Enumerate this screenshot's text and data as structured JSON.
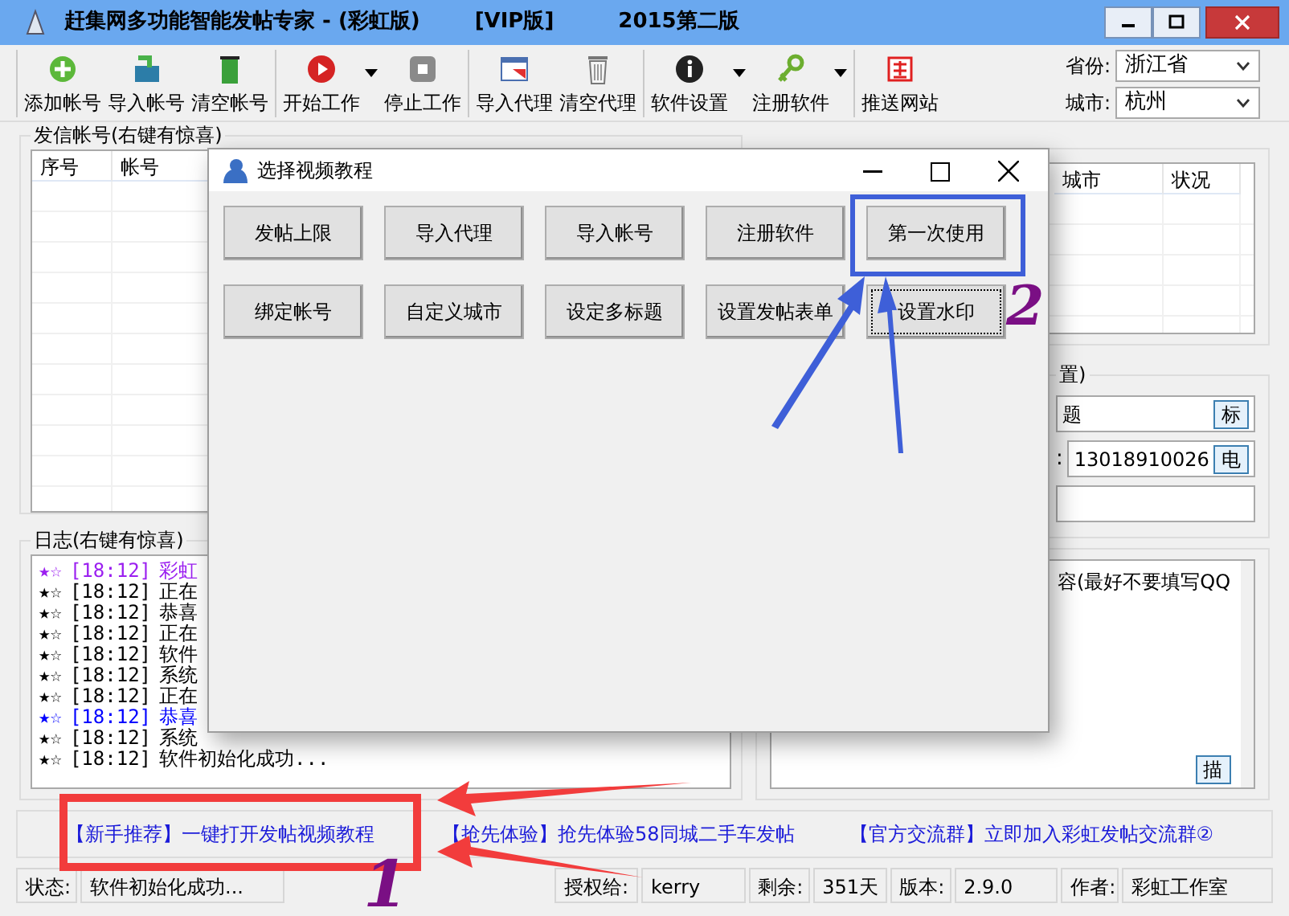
{
  "window": {
    "title_parts": [
      "赶集网多功能智能发帖专家 - (彩虹版)",
      "[VIP版]",
      "2015第二版"
    ]
  },
  "toolbar": {
    "groups": [
      [
        {
          "label": "添加帐号",
          "dropdown": false
        },
        {
          "label": "导入帐号",
          "dropdown": false
        },
        {
          "label": "清空帐号",
          "dropdown": false
        }
      ],
      [
        {
          "label": "开始工作",
          "dropdown": true
        },
        {
          "label": "停止工作",
          "dropdown": false
        }
      ],
      [
        {
          "label": "导入代理",
          "dropdown": false
        },
        {
          "label": "清空代理",
          "dropdown": false
        }
      ],
      [
        {
          "label": "软件设置",
          "dropdown": true
        },
        {
          "label": "注册软件",
          "dropdown": true
        }
      ],
      [
        {
          "label": "推送网站",
          "dropdown": false
        }
      ]
    ],
    "province": {
      "label": "省份:",
      "value": "浙江省"
    },
    "city": {
      "label": "城市:",
      "value": "杭州"
    }
  },
  "accounts": {
    "title": "发信帐号(右键有惊喜)",
    "columns": [
      "序号",
      "帐号"
    ]
  },
  "log": {
    "title": "日志(右键有惊喜)",
    "lines": [
      {
        "stars": "★☆",
        "time": "[18:12]",
        "text": "彩虹",
        "color": "#9b1ff0"
      },
      {
        "stars": "★☆",
        "time": "[18:12]",
        "text": "正在",
        "color": "#000000"
      },
      {
        "stars": "★☆",
        "time": "[18:12]",
        "text": "恭喜",
        "color": "#000000"
      },
      {
        "stars": "★☆",
        "time": "[18:12]",
        "text": "正在",
        "color": "#000000"
      },
      {
        "stars": "★☆",
        "time": "[18:12]",
        "text": "软件",
        "color": "#000000"
      },
      {
        "stars": "★☆",
        "time": "[18:12]",
        "text": "系统",
        "color": "#000000"
      },
      {
        "stars": "★☆",
        "time": "[18:12]",
        "text": "正在",
        "color": "#000000"
      },
      {
        "stars": "★☆",
        "time": "[18:12]",
        "text": "恭喜",
        "color": "#0000ff"
      },
      {
        "stars": "★☆",
        "time": "[18:12]",
        "text": "系统",
        "color": "#000000"
      },
      {
        "stars": "★☆",
        "time": "[18:12]",
        "text": "软件初始化成功...",
        "color": "#000000"
      }
    ]
  },
  "proxy": {
    "columns": [
      "城市",
      "状况"
    ]
  },
  "config": {
    "title": "置)",
    "title_field": {
      "value": "题",
      "button": "标"
    },
    "phone": {
      "label": ":",
      "value": "13018910026",
      "button": "电"
    },
    "content": {
      "value": "容(最好不要填写QQ",
      "button": "描"
    }
  },
  "links": [
    "【新手推荐】一键打开发帖视频教程",
    "【抢先体验】抢先体验58同城二手车发帖",
    "【官方交流群】立即加入彩虹发帖交流群②"
  ],
  "status_bar": [
    {
      "label": "状态:",
      "value": "软件初始化成功..."
    },
    {
      "label": "授权给:",
      "value": "kerry"
    },
    {
      "label": "剩余:",
      "value": "351天"
    },
    {
      "label": "版本:",
      "value": "2.9.0"
    },
    {
      "label": "作者:",
      "value": "彩虹工作室"
    }
  ],
  "dialog": {
    "title": "选择视频教程",
    "buttons": [
      {
        "label": "发帖上限",
        "focused": false
      },
      {
        "label": "导入代理",
        "focused": false
      },
      {
        "label": "导入帐号",
        "focused": false
      },
      {
        "label": "注册软件",
        "focused": false
      },
      {
        "label": "第一次使用",
        "focused": false
      },
      {
        "label": "绑定帐号",
        "focused": false
      },
      {
        "label": "自定义城市",
        "focused": false
      },
      {
        "label": "设定多标题",
        "focused": false
      },
      {
        "label": "设置发帖表单",
        "focused": false
      },
      {
        "label": "设置水印",
        "focused": true
      }
    ]
  },
  "annotations": [
    {
      "kind": "frame",
      "color": "#f23c3c"
    },
    {
      "kind": "arrow",
      "color": "#f23c3c"
    },
    {
      "kind": "arrow",
      "color": "#f23c3c"
    },
    {
      "kind": "number",
      "label": "1",
      "color": "#7a0f84"
    },
    {
      "kind": "frame",
      "color": "#3e5fd8"
    },
    {
      "kind": "arrow",
      "color": "#3e5fd8"
    },
    {
      "kind": "arrow",
      "color": "#3e5fd8"
    },
    {
      "kind": "number",
      "label": "2",
      "color": "#7a0f84"
    }
  ]
}
